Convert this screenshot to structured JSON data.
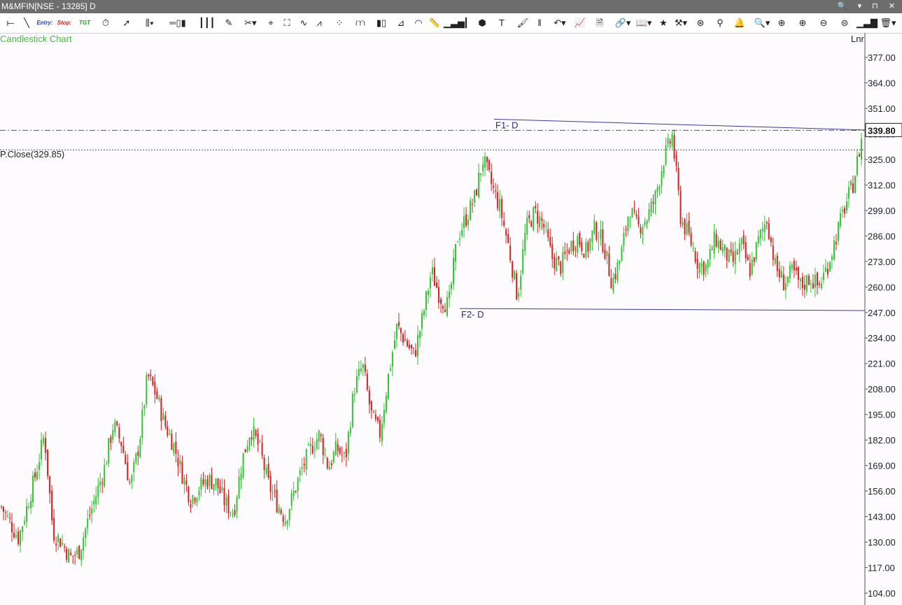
{
  "window": {
    "title": "M&MFIN[NSE - 13285] D"
  },
  "toolbar": {
    "entry_label": "Entry:",
    "stop_label": "Stop:",
    "tgt_label": "TGT"
  },
  "chart_header": {
    "type_label": "Candlestick Chart",
    "scale_label": "Lnr"
  },
  "prev_close_label": "P.Close(329.85)",
  "current_price_label": "339.80",
  "chart_data": {
    "type": "candlestick",
    "title": "",
    "y_ticks": [
      "377.00",
      "364.00",
      "351.00",
      "338.00",
      "325.00",
      "312.00",
      "299.00",
      "286.00",
      "273.00",
      "260.00",
      "247.00",
      "234.00",
      "221.00",
      "208.00",
      "195.00",
      "182.00",
      "169.00",
      "156.00",
      "143.00",
      "130.00",
      "117.00",
      "104.00"
    ],
    "ylim": [
      100,
      382
    ],
    "current_price": 339.8,
    "prev_close": 329.85,
    "trendlines": [
      {
        "label": "F1- D",
        "start_index": 0.0,
        "start": 345.5,
        "end_index": 1.0,
        "end": 340.0
      },
      {
        "label": "F2- D",
        "start_index": 0.0,
        "start": 249.0,
        "end_index": 1.0,
        "end": 248.0
      }
    ],
    "approx_close_path": [
      [
        0,
        148
      ],
      [
        2,
        132
      ],
      [
        4,
        165
      ],
      [
        5,
        185
      ],
      [
        6,
        135
      ],
      [
        7,
        130
      ],
      [
        8,
        122
      ],
      [
        9,
        125
      ],
      [
        10,
        140
      ],
      [
        12,
        168
      ],
      [
        13,
        190
      ],
      [
        14,
        180
      ],
      [
        15,
        158
      ],
      [
        16,
        180
      ],
      [
        17,
        215
      ],
      [
        18,
        205
      ],
      [
        19,
        190
      ],
      [
        20,
        180
      ],
      [
        21,
        165
      ],
      [
        22,
        152
      ],
      [
        23,
        158
      ],
      [
        24,
        162
      ],
      [
        25,
        160
      ],
      [
        26,
        150
      ],
      [
        27,
        145
      ],
      [
        28,
        172
      ],
      [
        29,
        188
      ],
      [
        30,
        178
      ],
      [
        31,
        160
      ],
      [
        32,
        150
      ],
      [
        33,
        142
      ],
      [
        34,
        155
      ],
      [
        35,
        168
      ],
      [
        36,
        178
      ],
      [
        37,
        185
      ],
      [
        38,
        168
      ],
      [
        39,
        178
      ],
      [
        40,
        172
      ],
      [
        41,
        208
      ],
      [
        42,
        220
      ],
      [
        43,
        195
      ],
      [
        44,
        185
      ],
      [
        45,
        215
      ],
      [
        46,
        240
      ],
      [
        47,
        232
      ],
      [
        48,
        225
      ],
      [
        49,
        245
      ],
      [
        50,
        268
      ],
      [
        51,
        255
      ],
      [
        52,
        250
      ],
      [
        53,
        285
      ],
      [
        54,
        295
      ],
      [
        55,
        305
      ],
      [
        56,
        325
      ],
      [
        57,
        312
      ],
      [
        58,
        300
      ],
      [
        59,
        280
      ],
      [
        60,
        255
      ],
      [
        61,
        290
      ],
      [
        62,
        298
      ],
      [
        63,
        292
      ],
      [
        64,
        275
      ],
      [
        65,
        270
      ],
      [
        66,
        280
      ],
      [
        67,
        285
      ],
      [
        68,
        278
      ],
      [
        69,
        290
      ],
      [
        70,
        282
      ],
      [
        71,
        262
      ],
      [
        72,
        275
      ],
      [
        73,
        300
      ],
      [
        74,
        290
      ],
      [
        75,
        295
      ],
      [
        76,
        305
      ],
      [
        77,
        325
      ],
      [
        78,
        337
      ],
      [
        79,
        295
      ],
      [
        80,
        285
      ],
      [
        81,
        272
      ],
      [
        82,
        270
      ],
      [
        83,
        285
      ],
      [
        84,
        278
      ],
      [
        85,
        272
      ],
      [
        86,
        282
      ],
      [
        87,
        268
      ],
      [
        88,
        283
      ],
      [
        89,
        295
      ],
      [
        90,
        270
      ],
      [
        91,
        262
      ],
      [
        92,
        268
      ],
      [
        93,
        260
      ],
      [
        94,
        265
      ],
      [
        95,
        260
      ],
      [
        96,
        270
      ],
      [
        97,
        285
      ],
      [
        98,
        300
      ],
      [
        99,
        312
      ],
      [
        100,
        335
      ]
    ]
  }
}
